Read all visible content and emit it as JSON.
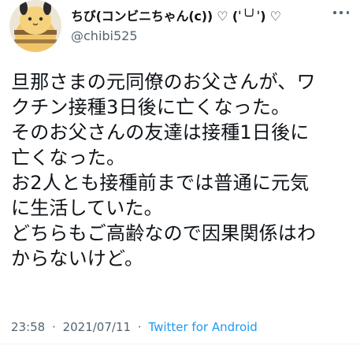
{
  "tweet": {
    "display_name": "ちび(コンビニちゃん(c)) ♡ (ˈ╰╯ˈ) ♡",
    "username": "@chibi525",
    "body_lines": [
      "旦那さまの元同僚のお父さんが、ワ",
      "クチン接種3日後に亡くなった。",
      "そのお父さんの友達は接種1日後に",
      "亡くなった。",
      "お2人とも接種前までは普通に元気",
      "に生活していた。",
      "どちらもご高齢なので因果関係はわ",
      "からないけど。"
    ],
    "time": "23:58",
    "separator": "·",
    "date": "2021/07/11",
    "source": "Twitter for Android"
  },
  "icons": {
    "avatar": "avatar-icon",
    "more": "more-options-icon"
  },
  "colors": {
    "text": "#0f1419",
    "muted": "#536471",
    "link": "#1d9bf0"
  }
}
